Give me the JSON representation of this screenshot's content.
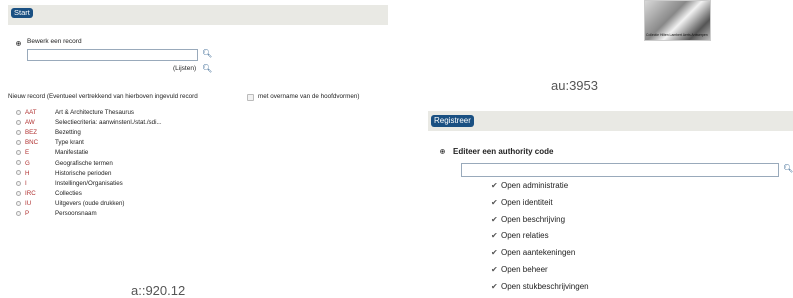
{
  "left": {
    "start_button": "Start",
    "edit_record_label": "Bewerk een record",
    "edit_record_value": "",
    "lists_link": "(Lijsten)",
    "new_record_label": "Nieuw record (Eventueel vertrekkend van hierboven ingevuld record",
    "with_headings_label": "met overname van de hoofdvormen)",
    "record_types": [
      {
        "code": "AAT",
        "label": "Art & Architecture Thesaurus"
      },
      {
        "code": "AW",
        "label": "Selectiecriteria: aanwinstenl./stat./sdi..."
      },
      {
        "code": "BEZ",
        "label": "Bezetting"
      },
      {
        "code": "BNC",
        "label": "Type krant"
      },
      {
        "code": "E",
        "label": "Manifestatie"
      },
      {
        "code": "G",
        "label": "Geografische termen"
      },
      {
        "code": "H",
        "label": "Historische perioden"
      },
      {
        "code": "I",
        "label": "Instellingen/Organisaties"
      },
      {
        "code": "IRC",
        "label": "Collecties"
      },
      {
        "code": "IU",
        "label": "Uitgevers (oude drukken)"
      },
      {
        "code": "P",
        "label": "Persoonsnaam"
      }
    ],
    "caption": "a::920.12"
  },
  "right": {
    "thumbnail_caption": "Collectie Hilten Lambert Aerts Antwerpen",
    "caption": "au:3953",
    "register_button": "Registreer",
    "edit_authority_label": "Editeer een authority code",
    "authority_value": "",
    "options": [
      "Open administratie",
      "Open identiteit",
      "Open beschrijving",
      "Open relaties",
      "Open aantekeningen",
      "Open beheer",
      "Open stukbeschrijvingen"
    ]
  },
  "icons": {
    "search": "magnifier-icon",
    "check": "checkmark-icon"
  },
  "colors": {
    "button_bg": "#1a5082",
    "code_text": "#b03030",
    "bar_bg": "#e9e9e4"
  }
}
